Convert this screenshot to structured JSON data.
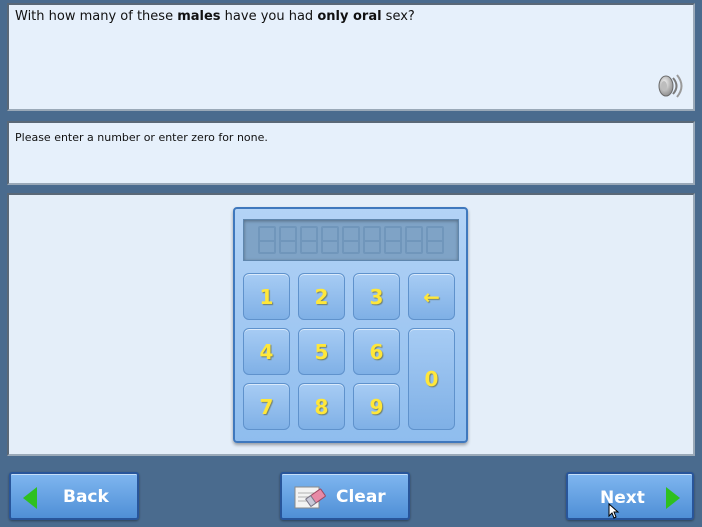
{
  "question": {
    "parts": [
      "With how many of these ",
      "males",
      " have you had ",
      "only oral",
      " sex?"
    ]
  },
  "instruction": "Please enter a number or enter zero for none.",
  "keypad": {
    "display_value": "",
    "display_slots": 9,
    "keys": [
      "1",
      "2",
      "3",
      "←",
      "4",
      "5",
      "6",
      "0",
      "7",
      "8",
      "9"
    ]
  },
  "buttons": {
    "back": "Back",
    "clear": "Clear",
    "next": "Next"
  },
  "icons": {
    "speaker": "speaker-icon",
    "back": "left-arrow-icon",
    "clear": "eraser-icon",
    "next": "right-arrow-icon"
  },
  "colors": {
    "background": "#4a6b8e",
    "panel": "#e6f0fb",
    "key_text": "#ffe73a",
    "arrow": "#2ec01f",
    "button": "#4f8fd6"
  }
}
